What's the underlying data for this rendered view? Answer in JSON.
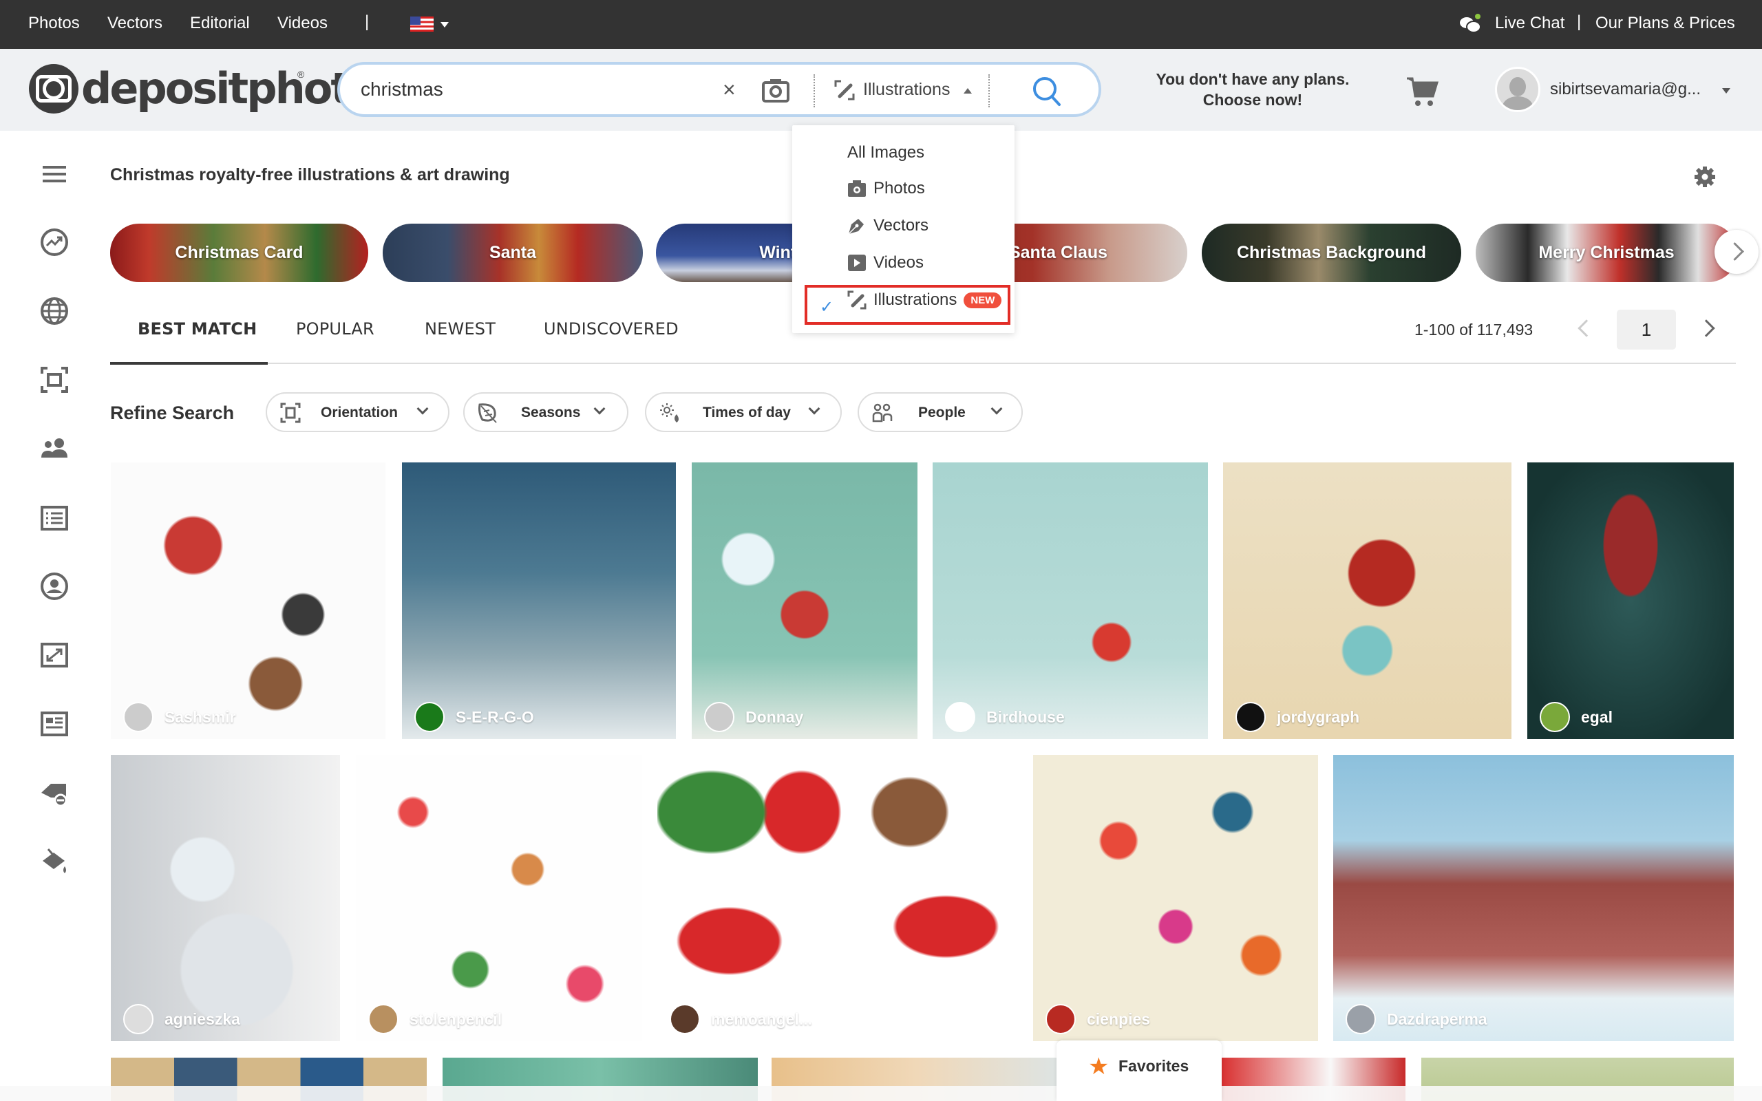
{
  "topbar": {
    "nav": [
      "Photos",
      "Vectors",
      "Editorial",
      "Videos"
    ],
    "separator": "|",
    "language_flag": "us-flag",
    "live_chat": "Live Chat",
    "divider": "|",
    "plans_link": "Our Plans & Prices",
    "chat_status_color": "#8dc63f"
  },
  "header": {
    "logo_text": "depositphotos",
    "logo_reg": "®",
    "search": {
      "value": "christmas",
      "clear_label": "×",
      "type_selected": "Illustrations"
    },
    "plans_message_line1": "You don't have any plans.",
    "plans_message_line2": "Choose now!",
    "user_email": "sibirtsevamaria@g..."
  },
  "type_dropdown": {
    "options": [
      {
        "label": "All Images",
        "icon": "none"
      },
      {
        "label": "Photos",
        "icon": "camera-icon"
      },
      {
        "label": "Vectors",
        "icon": "pen-nib-icon"
      },
      {
        "label": "Videos",
        "icon": "play-icon"
      },
      {
        "label": "Illustrations",
        "icon": "illustration-icon",
        "badge": "NEW",
        "selected": true
      }
    ],
    "highlight_color": "#e22d27",
    "badge_color": "#f04f3c",
    "check_color": "#3d8ee0"
  },
  "sidebar": {
    "items": [
      {
        "icon": "menu-icon"
      },
      {
        "icon": "trending-icon"
      },
      {
        "icon": "globe-icon"
      },
      {
        "icon": "focus-frame-icon"
      },
      {
        "icon": "people-icon"
      },
      {
        "icon": "list-icon"
      },
      {
        "icon": "account-circle-icon"
      },
      {
        "icon": "resize-icon"
      },
      {
        "icon": "article-icon"
      },
      {
        "icon": "tag-icon"
      },
      {
        "icon": "paint-bucket-icon"
      }
    ]
  },
  "page": {
    "title": "Christmas royalty-free illustrations & art drawing"
  },
  "chips": [
    {
      "label": "Christmas Card"
    },
    {
      "label": "Santa"
    },
    {
      "label": "Winter"
    },
    {
      "label": "Santa Claus"
    },
    {
      "label": "Christmas Background"
    },
    {
      "label": "Merry Christmas"
    }
  ],
  "tabs": [
    {
      "label": "BEST MATCH",
      "active": true
    },
    {
      "label": "POPULAR"
    },
    {
      "label": "NEWEST"
    },
    {
      "label": "UNDISCOVERED"
    }
  ],
  "pagination": {
    "range": "1-100 of 117,493",
    "page": "1"
  },
  "refine": {
    "label": "Refine Search",
    "filters": [
      {
        "label": "Orientation",
        "icon": "orientation-icon"
      },
      {
        "label": "Seasons",
        "icon": "leaf-icon"
      },
      {
        "label": "Times of day",
        "icon": "day-night-icon"
      },
      {
        "label": "People",
        "icon": "people-outline-icon"
      }
    ]
  },
  "results": {
    "row1": [
      {
        "author": "Sashsmir"
      },
      {
        "author": "S-E-R-G-O"
      },
      {
        "author": "Donnay"
      },
      {
        "author": "Birdhouse"
      },
      {
        "author": "jordygraph"
      },
      {
        "author": "egal"
      }
    ],
    "row2": [
      {
        "author": "agnieszka"
      },
      {
        "author": "stolenpencil"
      },
      {
        "author": "memoangel..."
      },
      {
        "author": "cienpies"
      },
      {
        "author": "Dazdraperma"
      }
    ]
  },
  "favorites": {
    "label": "Favorites",
    "star_color": "#f47c20"
  }
}
